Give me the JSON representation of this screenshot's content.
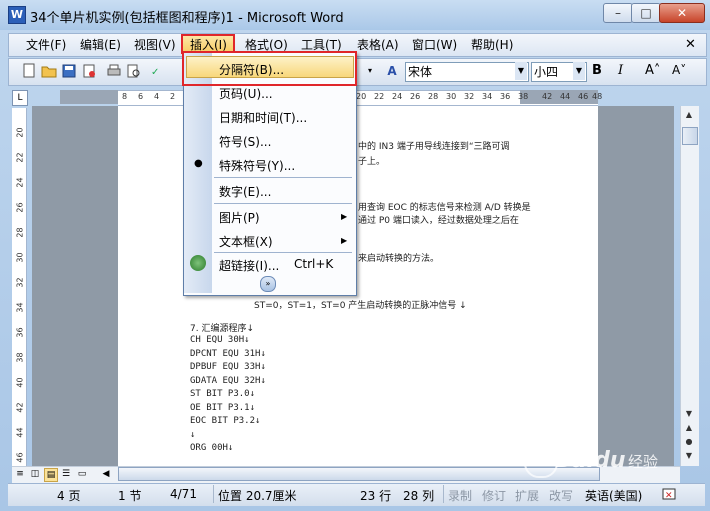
{
  "window": {
    "title": "34个单片机实例(包括框图和程序)1 - Microsoft Word",
    "app_icon_letter": "W"
  },
  "caption_buttons": {
    "minimize": "–",
    "maximize": "□",
    "close": "✕"
  },
  "menubar": {
    "items": [
      "文件(F)",
      "编辑(E)",
      "视图(V)",
      "插入(I)",
      "格式(O)",
      "工具(T)",
      "表格(A)",
      "窗口(W)",
      "帮助(H)"
    ],
    "close_glyph": "✕"
  },
  "toolbar": {
    "style_value": "宋体",
    "size_value": "小四",
    "bold": "B",
    "italic": "I",
    "grow": "A˄",
    "shrink": "A˅",
    "font_color_label": "A"
  },
  "ruler": {
    "numbers": [
      "8",
      "6",
      "4",
      "2",
      "20",
      "22",
      "24",
      "26",
      "28",
      "30",
      "32",
      "34",
      "36",
      "38",
      "42",
      "44",
      "46",
      "48"
    ]
  },
  "vruler": {
    "numbers": [
      "20",
      "22",
      "24",
      "26",
      "28",
      "30",
      "32",
      "34",
      "36",
      "38",
      "40",
      "42",
      "44",
      "46"
    ]
  },
  "insert_menu": {
    "items": [
      {
        "label": "分隔符(B)...",
        "has_submenu": false
      },
      {
        "label": "页码(U)...",
        "has_submenu": false
      },
      {
        "label": "日期和时间(T)...",
        "has_submenu": false
      },
      {
        "label": "符号(S)...",
        "has_submenu": false
      },
      {
        "label": "特殊符号(Y)...",
        "has_submenu": false
      },
      {
        "label": "数字(E)...",
        "has_submenu": false
      },
      {
        "label": "图片(P)",
        "has_submenu": true
      },
      {
        "label": "文本框(X)",
        "has_submenu": true
      },
      {
        "label": "超链接(I)...",
        "shortcut": "Ctrl+K",
        "has_submenu": false
      }
    ],
    "expand_glyph": "»"
  },
  "document": {
    "fragments": [
      "中的 IN3 端子用导线连接到“三路可调",
      "子上。",
      "用查询 EOC 的标志信号来检测 A/D 转换是",
      "通过 P0 端口读入，经过数据处理之后在",
      "来启动转换的方法。"
    ],
    "st_line": "ST=0，ST=1，ST=0 产生启动转换的正脉冲信号 ↓",
    "section_title": "7.  汇编源程序↓",
    "code_lines": [
      "CH EQU 30H↓",
      "DPCNT EQU 31H↓",
      "DPBUF EQU 33H↓",
      "GDATA EQU 32H↓",
      "ST BIT P3.0↓",
      "OE BIT P3.1↓",
      "EOC BIT P3.2↓",
      "↓",
      "ORG 00H↓"
    ]
  },
  "statusbar": {
    "page": "4 页",
    "section": "1 节",
    "page_of": "4/71",
    "position": "位置 20.7厘米",
    "line": "23 行",
    "column": "28 列",
    "rec": "录制",
    "trk": "修订",
    "ext": "扩展",
    "ovr": "改写",
    "language": "英语(美国)"
  },
  "watermark": {
    "text": "Baidu",
    "cn": "经验"
  }
}
